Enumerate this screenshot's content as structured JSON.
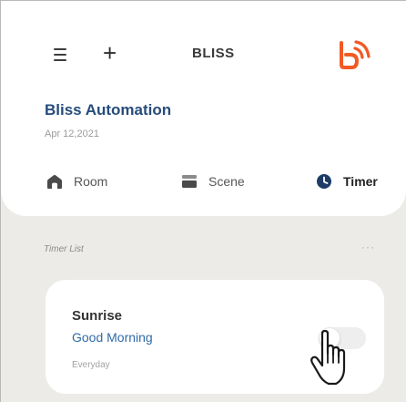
{
  "header": {
    "menu_icon": "hamburger-icon",
    "add_label": "+",
    "brand": "BLISS",
    "logo_icon": "bliss-logo-icon",
    "logo_color": "#f15a24"
  },
  "home": {
    "title": "Bliss Automation",
    "date": "Apr 12,2021"
  },
  "tabs": [
    {
      "label": "Room",
      "icon": "house-icon",
      "active": false
    },
    {
      "label": "Scene",
      "icon": "scene-icon",
      "active": false
    },
    {
      "label": "Timer",
      "icon": "clock-icon",
      "active": true
    }
  ],
  "timer_list": {
    "label": "Timer List",
    "more": "···",
    "items": [
      {
        "name": "Sunrise",
        "subtitle": "Good Morning",
        "repeat": "Everyday",
        "enabled": false
      }
    ]
  },
  "colors": {
    "accent_blue": "#264c7a",
    "subtitle_blue": "#2f6aa8",
    "background": "#ecebe8"
  }
}
